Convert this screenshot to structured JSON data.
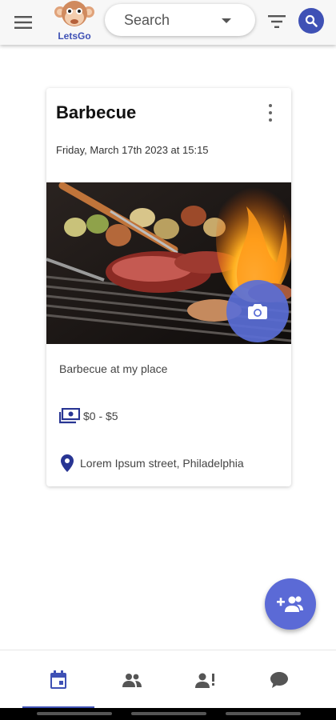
{
  "app": {
    "logo_text": "LetsGo"
  },
  "header": {
    "search_placeholder": "Search"
  },
  "event": {
    "title": "Barbecue",
    "datetime": "Friday, March 17th 2023 at 15:15",
    "description": "Barbecue at my place",
    "price": "$0 - $5",
    "location": "Lorem Ipsum street, Philadelphia"
  },
  "bottom_nav": {
    "items": [
      {
        "icon": "calendar-icon",
        "active": true
      },
      {
        "icon": "group-icon",
        "active": false
      },
      {
        "icon": "person-alert-icon",
        "active": false
      },
      {
        "icon": "chat-icon",
        "active": false
      }
    ]
  },
  "colors": {
    "primary": "#3f51b5",
    "fab": "#5b6ad6",
    "topbar": "#f7f7f7"
  }
}
